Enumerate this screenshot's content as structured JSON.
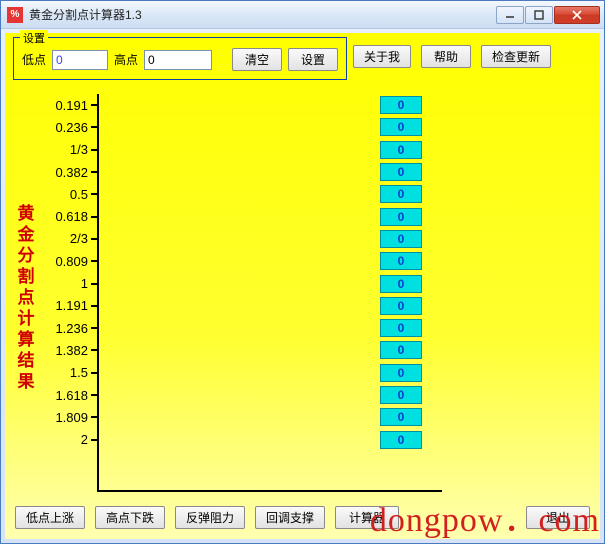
{
  "window": {
    "title": "黄金分割点计算器1.3"
  },
  "settings": {
    "groupLabel": "设置",
    "lowLabel": "低点",
    "lowValue": "0",
    "highLabel": "高点",
    "highValue": "0",
    "clearLabel": "清空",
    "setLabel": "设置"
  },
  "topButtons": {
    "about": "关于我",
    "help": "帮助",
    "update": "检查更新"
  },
  "resultsTitle": "黄金分割点计算结果",
  "rows": [
    {
      "ratio": "0.191",
      "value": "0"
    },
    {
      "ratio": "0.236",
      "value": "0"
    },
    {
      "ratio": "1/3",
      "value": "0"
    },
    {
      "ratio": "0.382",
      "value": "0"
    },
    {
      "ratio": "0.5",
      "value": "0"
    },
    {
      "ratio": "0.618",
      "value": "0"
    },
    {
      "ratio": "2/3",
      "value": "0"
    },
    {
      "ratio": "0.809",
      "value": "0"
    },
    {
      "ratio": "1",
      "value": "0"
    },
    {
      "ratio": "1.191",
      "value": "0"
    },
    {
      "ratio": "1.236",
      "value": "0"
    },
    {
      "ratio": "1.382",
      "value": "0"
    },
    {
      "ratio": "1.5",
      "value": "0"
    },
    {
      "ratio": "1.618",
      "value": "0"
    },
    {
      "ratio": "1.809",
      "value": "0"
    },
    {
      "ratio": "2",
      "value": "0"
    }
  ],
  "bottomButtons": {
    "lowRise": "低点上涨",
    "highDrop": "高点下跌",
    "rebound": "反弹阻力",
    "pullback": "回调支撑",
    "calculator": "计算器",
    "exit": "退出"
  },
  "watermark": "dongpow．com"
}
